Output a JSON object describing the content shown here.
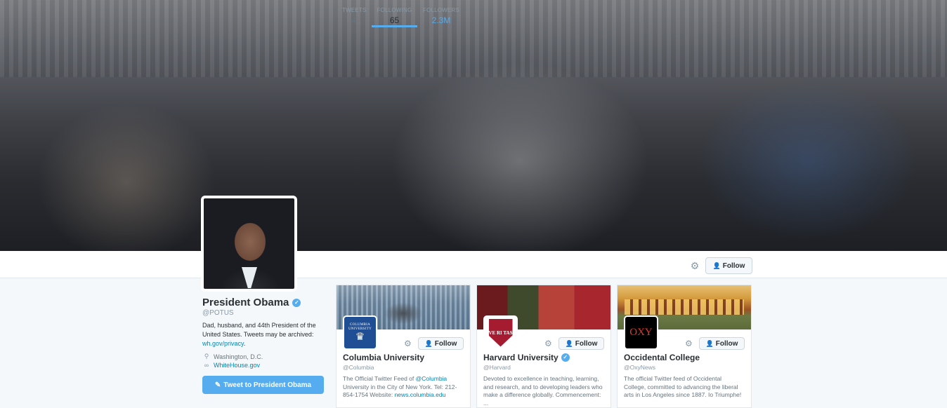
{
  "profile": {
    "name": "President Obama",
    "handle": "@POTUS",
    "bio_text": "Dad, husband, and 44th President of the United States. Tweets may be archived: ",
    "bio_link": "wh.gov/privacy",
    "bio_end": ".",
    "location": "Washington, D.C.",
    "website": "WhiteHouse.gov",
    "tweet_button": "Tweet to President Obama"
  },
  "nav": {
    "stats": [
      {
        "label": "TWEETS",
        "value": "4"
      },
      {
        "label": "FOLLOWING",
        "value": "65"
      },
      {
        "label": "FOLLOWERS",
        "value": "2.3M"
      }
    ],
    "active_tab": "FOLLOWING",
    "follow_label": "Follow"
  },
  "cards": [
    {
      "name": "Columbia University",
      "handle": "@Columbia",
      "verified": false,
      "bio_pre": "The Official Twitter Feed of ",
      "bio_mention": "@Columbia",
      "bio_mid": " University in the City of New York. Tel: 212-854-1754 Website: ",
      "bio_link": "news.columbia.edu",
      "logo_text": "COLUMBIA UNIVERSITY",
      "follow_label": "Follow"
    },
    {
      "name": "Harvard University",
      "handle": "@Harvard",
      "verified": true,
      "bio_pre": "Devoted to excellence in teaching, learning, and research, and to developing leaders who make a difference globally. Commencement: ...",
      "bio_mention": "",
      "bio_mid": "",
      "bio_link": "",
      "logo_text": "VE RI TAS",
      "follow_label": "Follow"
    },
    {
      "name": "Occidental College",
      "handle": "@OxyNews",
      "verified": false,
      "bio_pre": "The official Twitter feed of Occidental College, committed to advancing the liberal arts in Los Angeles since 1887. Io Triumphe!",
      "bio_mention": "",
      "bio_mid": "",
      "bio_link": "",
      "logo_text": "OXY",
      "follow_label": "Follow"
    }
  ],
  "colors": {
    "accent": "#55acee",
    "link": "#0084b4",
    "text": "#292f33",
    "muted": "#8899a6",
    "background": "#f5f8fa"
  },
  "icons": {
    "verified": "verified-badge-icon",
    "gear": "gear-icon",
    "follow": "add-user-icon",
    "location": "location-pin-icon",
    "link": "link-icon",
    "compose": "compose-tweet-icon"
  }
}
